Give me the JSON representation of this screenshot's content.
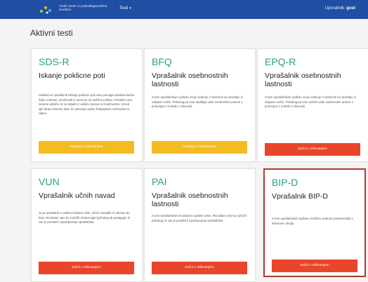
{
  "header": {
    "brand": "Vrstič center za psihodiagnostična sredstva",
    "menu_label": "Testi",
    "user_prefix": "Uporabnik:",
    "user_name": "gost"
  },
  "page": {
    "title": "Aktivni testi"
  },
  "tests": [
    {
      "code": "SDS-R",
      "name": "Iskanje poklicne poti",
      "description": "Holland ov vprašalnik Iskanje poklicne poti vam pomaga raziskati lastne želje, interese, zmožnosti in interese za različne poklice. Preteklo vam nemem pokliče, ki so skladni z vašimi interesi in zmožnostmi. Izmed njih lahko izberete tiste, ki ustrezajo vašim življenjskim možnostim in ciljem.",
      "button_label": "Nadaljuj z reševanjem",
      "button_style": "yellow"
    },
    {
      "code": "BFQ",
      "name": "Vprašalnik osebnostnih lastnosti",
      "description": "S tem vprašalnikom opišete svoje vedenje in lastnosti na zanesljiv in veljaven način. Psiholog pa vam nadaljnji vaše osebnostne poteze v primerjavi z vrstniki v Sloveniji.",
      "button_label": "Nadaljuj z reševanjem",
      "button_style": "yellow"
    },
    {
      "code": "EPQ-R",
      "name": "Vprašalnik osebnostnih lastnosti",
      "description": "S tem vprašalnikom opišete svoje vedenje in lastnosti na zanesljiv in veljaven način. Psiholog pa vam razloži vaše osebnostne poteze v primerjavi z vrstniki v Sloveniji.",
      "button_label": "Začni z reševanjem",
      "button_style": "red"
    },
    {
      "code": "VUN",
      "name": "Vprašalnik učnih navad",
      "description": "To je vprašalnik o vašem šolskem delu, učnih navadah in odnosu do šole. Rezultate vam bo razložil strokovnjak (psiholog ali pedagog), ki vas je povabil k izpolnjevanju vprašalnika.",
      "button_label": "Začni z reševanjem",
      "button_style": "red"
    },
    {
      "code": "PAI",
      "name": "Vprašalnik osebnostnih lastnosti",
      "description": "S tem vprašalnikom enostavno opišete sebe. Rezultate vam bo razložil psiholog, ki vas je povabil k izpolnjevanju vprašalnika.",
      "button_label": "Začni z reševanjem",
      "button_style": "red"
    },
    {
      "code": "BIP-D",
      "name": "Vprašalnik BIP-D",
      "description": "S tem vprašalnikom opišete značilno vedenje posameznika v delovnem okolju.",
      "button_label": "Začni z reševanjem",
      "button_style": "red"
    }
  ]
}
